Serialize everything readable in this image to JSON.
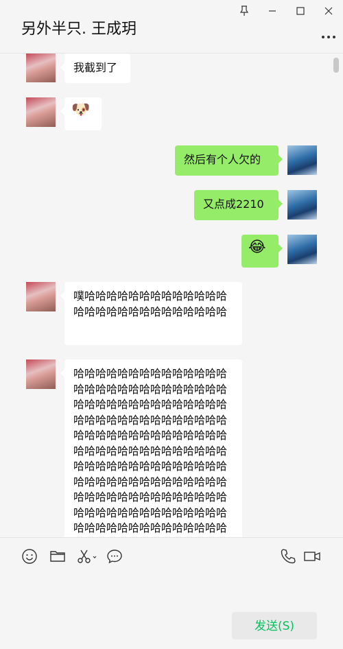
{
  "header": {
    "title": "另外半只. 王成玥"
  },
  "messages": [
    {
      "from": "friend",
      "text": "我截到了"
    },
    {
      "from": "friend",
      "type": "sticker",
      "text": "🐶"
    },
    {
      "from": "me",
      "text": "然后有个人欠的"
    },
    {
      "from": "me",
      "text": "又点成2210"
    },
    {
      "from": "me",
      "type": "emoji",
      "text": "😂"
    },
    {
      "from": "friend",
      "text": "噗哈哈哈哈哈哈哈哈哈哈哈哈哈哈哈哈哈哈哈哈哈哈哈哈哈哈哈"
    },
    {
      "from": "friend",
      "text": "哈哈哈哈哈哈哈哈哈哈哈哈哈哈哈哈哈哈哈哈哈哈哈哈哈哈哈哈哈哈哈哈哈哈哈哈哈哈哈哈哈哈哈哈哈哈哈哈哈哈哈哈哈哈哈哈哈哈哈哈哈哈哈哈哈哈哈哈哈哈哈哈哈哈哈哈哈哈哈哈哈哈哈哈哈哈哈哈哈哈哈哈哈哈哈哈哈哈哈哈哈哈哈哈哈哈哈哈哈哈哈哈哈哈哈哈哈哈哈哈哈哈哈哈哈哈哈哈哈哈哈哈哈哈哈哈哈哈哈哈哈哈哈哈哈哈哈哈哈哈哈哈哈哈"
    }
  ],
  "input": {
    "send_label": "发送(S)"
  },
  "icons": {
    "pin": "pin-icon",
    "minimize": "minimize-icon",
    "maximize": "maximize-icon",
    "close": "close-icon",
    "more": "more-icon",
    "emoji": "emoji-icon",
    "folder": "folder-icon",
    "screenshot": "scissors-icon",
    "history": "chat-history-icon",
    "voice_call": "phone-icon",
    "video_call": "video-icon"
  },
  "colors": {
    "outgoing_bubble": "#95ec69",
    "incoming_bubble": "#ffffff",
    "send_text": "#07c160"
  }
}
